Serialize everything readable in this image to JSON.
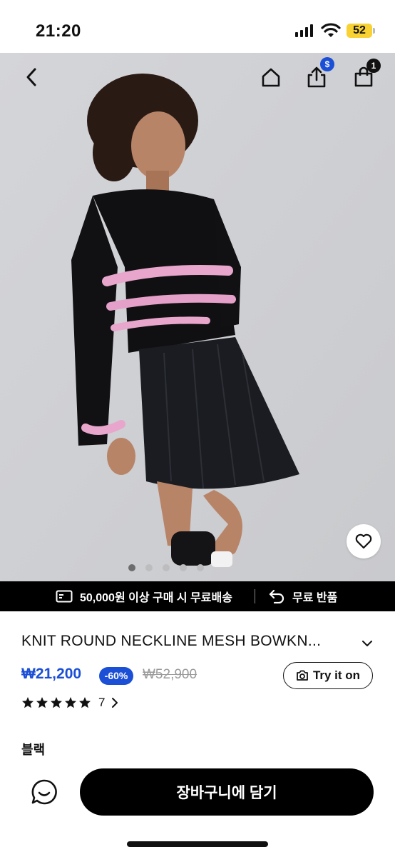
{
  "status_bar": {
    "time": "21:20",
    "battery": "52"
  },
  "nav": {
    "share_badge": "$",
    "cart_badge": "1",
    "icons": [
      "back-icon",
      "home-icon",
      "share-icon",
      "bag-icon"
    ]
  },
  "gallery": {
    "total_images": 5,
    "active_index": 0
  },
  "promo": {
    "shipping_text": "50,000원 이상 구매 시 무료배송",
    "return_text": "무료 반품"
  },
  "product": {
    "title": "KNIT ROUND NECKLINE MESH BOWKN...",
    "price": "₩21,200",
    "discount": "-60%",
    "original_price": "₩52,900",
    "try_on_label": "Try it on",
    "rating_stars": 5,
    "review_count": "7",
    "color_label": "블랙"
  },
  "actions": {
    "add_to_cart_label": "장바구니에 담기"
  },
  "colors": {
    "accent": "#1a4fd6",
    "black": "#000000",
    "battery": "#f7d232"
  }
}
